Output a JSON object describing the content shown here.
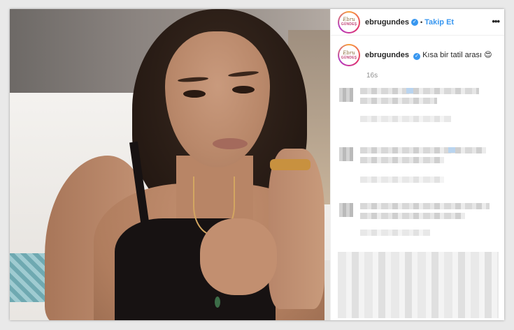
{
  "post": {
    "username": "ebrugundes",
    "follow_label": "Takip Et",
    "separator": "•",
    "more_label": "•••",
    "avatar_logo_top": "Ebru",
    "avatar_logo_bottom": "GÜNDEŞ",
    "caption_text": "Kısa bir tatil arası 😍",
    "caption_time": "16s"
  },
  "colors": {
    "accent": "#3897f0",
    "text": "#262626",
    "muted": "#8e8e8e"
  },
  "icons": {
    "verified": "verified-badge-icon",
    "more": "more-options-icon"
  }
}
